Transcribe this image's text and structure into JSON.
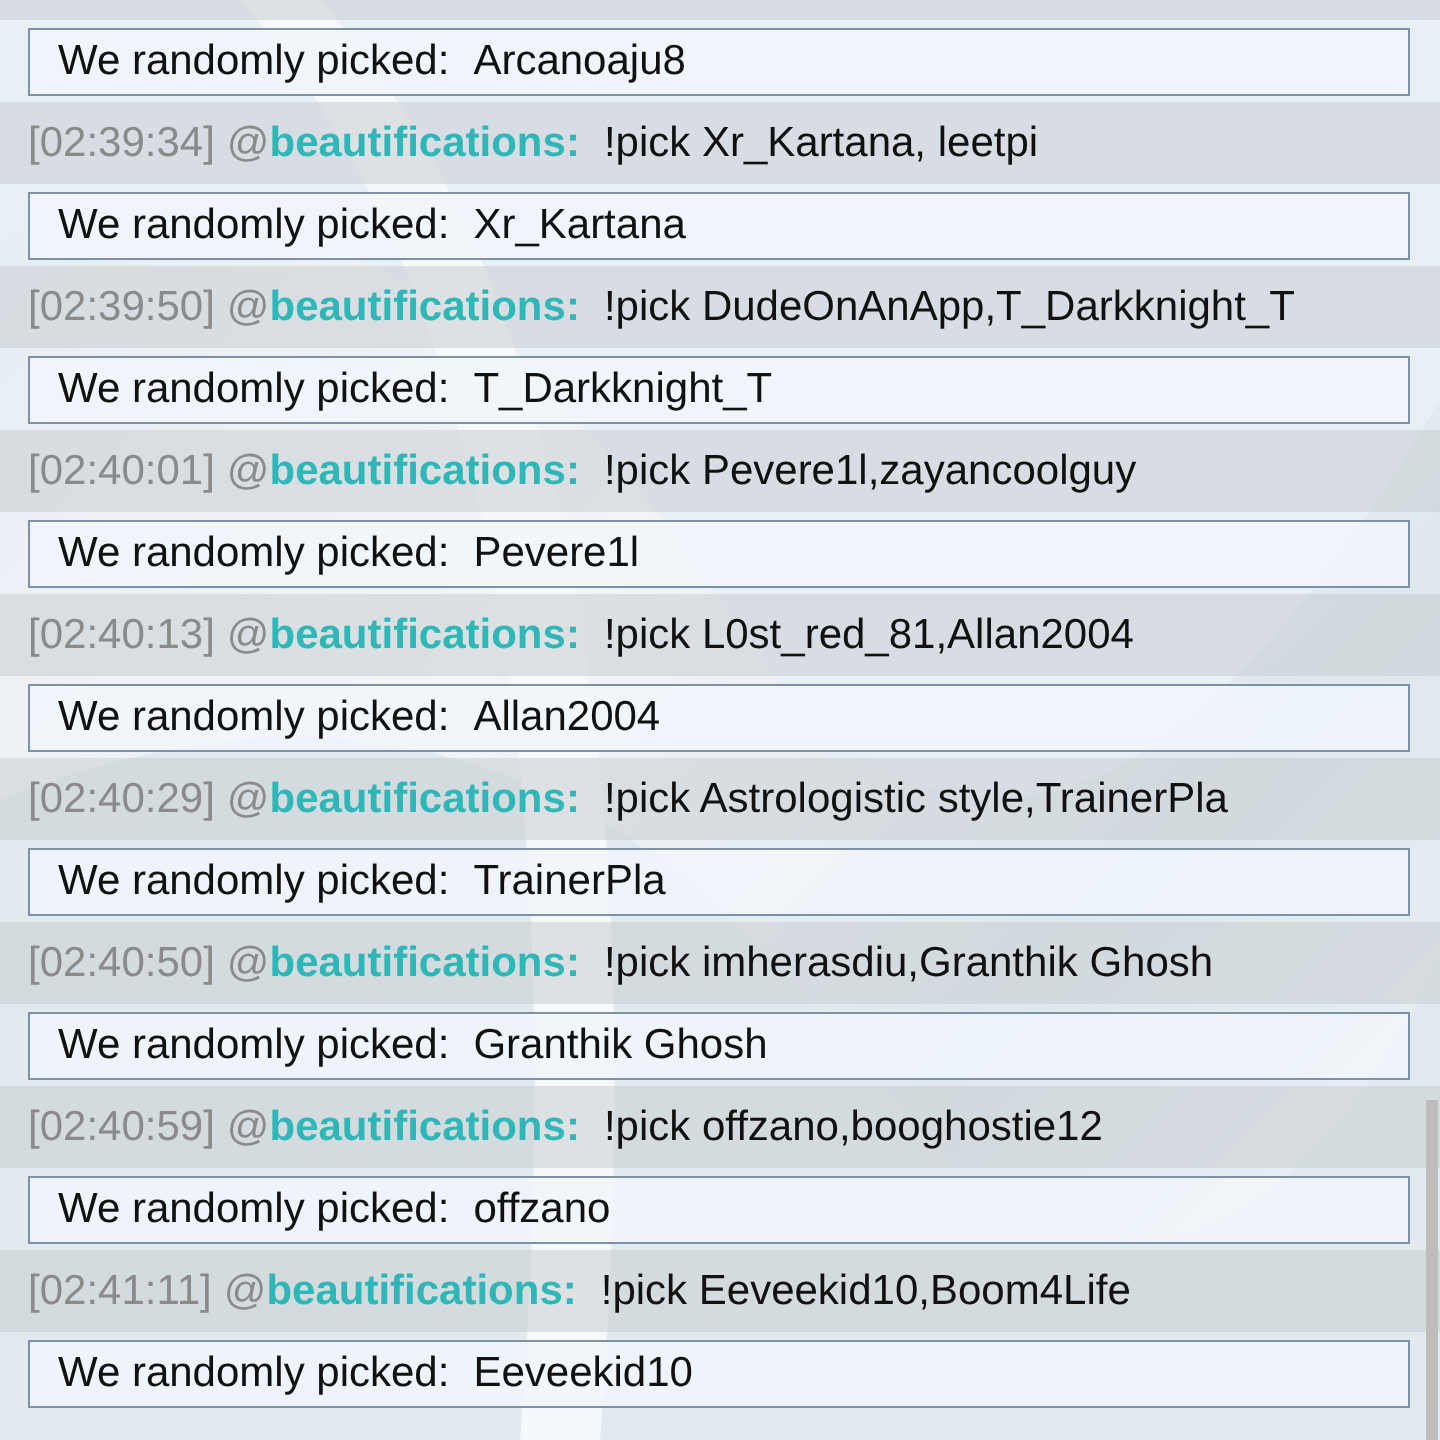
{
  "entries": [
    {
      "kind": "reply",
      "label": "We randomly picked:",
      "value": "Arcanoaju8"
    },
    {
      "kind": "command",
      "timestamp": "[02:39:34]",
      "at": "@",
      "user": "beautifications:",
      "text": "!pick Xr_Kartana, leetpi"
    },
    {
      "kind": "reply",
      "label": "We randomly picked:",
      "value": "Xr_Kartana"
    },
    {
      "kind": "command",
      "timestamp": "[02:39:50]",
      "at": "@",
      "user": "beautifications:",
      "text": "!pick DudeOnAnApp,T_Darkknight_T"
    },
    {
      "kind": "reply",
      "label": "We randomly picked:",
      "value": "T_Darkknight_T"
    },
    {
      "kind": "command",
      "timestamp": "[02:40:01]",
      "at": "@",
      "user": "beautifications:",
      "text": "!pick Pevere1l,zayancoolguy"
    },
    {
      "kind": "reply",
      "label": "We randomly picked:",
      "value": "Pevere1l"
    },
    {
      "kind": "command",
      "timestamp": "[02:40:13]",
      "at": "@",
      "user": "beautifications:",
      "text": "!pick L0st_red_81,Allan2004"
    },
    {
      "kind": "reply",
      "label": "We randomly picked:",
      "value": "Allan2004"
    },
    {
      "kind": "command",
      "timestamp": "[02:40:29]",
      "at": "@",
      "user": "beautifications:",
      "text": "!pick Astrologistic style,TrainerPla"
    },
    {
      "kind": "reply",
      "label": "We randomly picked:",
      "value": "TrainerPla"
    },
    {
      "kind": "command",
      "timestamp": "[02:40:50]",
      "at": "@",
      "user": "beautifications:",
      "text": "!pick imherasdiu,Granthik Ghosh"
    },
    {
      "kind": "reply",
      "label": "We randomly picked:",
      "value": "Granthik Ghosh"
    },
    {
      "kind": "command",
      "timestamp": "[02:40:59]",
      "at": "@",
      "user": "beautifications:",
      "text": "!pick offzano,booghostie12"
    },
    {
      "kind": "reply",
      "label": "We randomly picked:",
      "value": "offzano"
    },
    {
      "kind": "command",
      "timestamp": "[02:41:11]",
      "at": "@",
      "user": "beautifications:",
      "text": "!pick Eeveekid10,Boom4Life"
    },
    {
      "kind": "reply",
      "label": "We randomly picked:",
      "value": "Eeveekid10"
    }
  ]
}
